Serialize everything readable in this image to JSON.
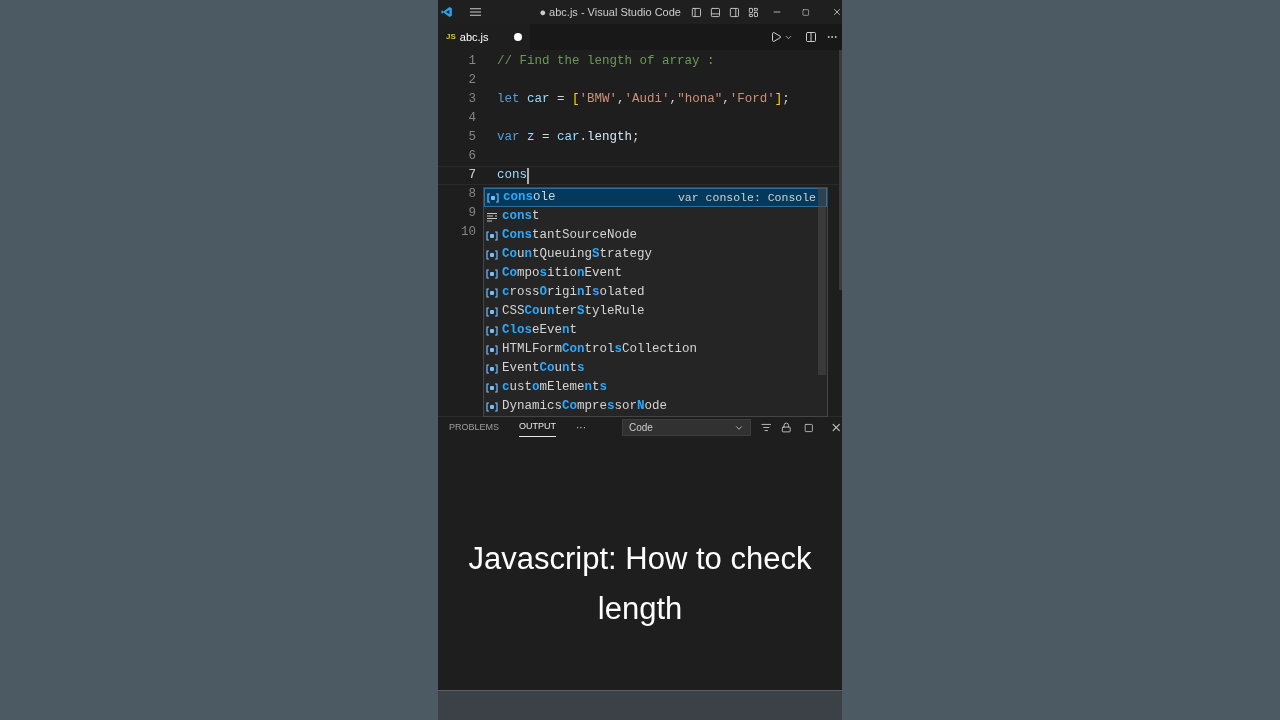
{
  "title_bar": {
    "title": "● abc.js - Visual Studio Code"
  },
  "tabs": [
    {
      "icon_text": "JS",
      "label": "abc.js",
      "selected": true,
      "modified": true
    }
  ],
  "editor": {
    "lines": [
      {
        "number": "1",
        "current": false,
        "tokens": [
          {
            "kind": "comment",
            "text": "// Find the length of array :"
          }
        ]
      },
      {
        "number": "2",
        "current": false
      },
      {
        "number": "3",
        "current": false,
        "tokens": [
          {
            "kind": "keyword",
            "text": "let "
          },
          {
            "kind": "variable",
            "text": "car"
          },
          {
            "kind": "plain",
            "text": " = "
          },
          {
            "kind": "bracket",
            "text": "["
          },
          {
            "kind": "string",
            "text": "'BMW'"
          },
          {
            "kind": "plain",
            "text": ","
          },
          {
            "kind": "string",
            "text": "'Audi'"
          },
          {
            "kind": "plain",
            "text": ","
          },
          {
            "kind": "string",
            "text": "\"hona\""
          },
          {
            "kind": "plain",
            "text": ","
          },
          {
            "kind": "string",
            "text": "'Ford'"
          },
          {
            "kind": "bracket",
            "text": "]"
          },
          {
            "kind": "plain",
            "text": ";"
          }
        ]
      },
      {
        "number": "4",
        "current": false
      },
      {
        "number": "5",
        "current": false,
        "tokens": [
          {
            "kind": "keyword",
            "text": "var "
          },
          {
            "kind": "variable",
            "text": "z"
          },
          {
            "kind": "plain",
            "text": " = "
          },
          {
            "kind": "variable",
            "text": "car"
          },
          {
            "kind": "plain",
            "text": "."
          },
          {
            "kind": "property",
            "text": "length"
          },
          {
            "kind": "plain",
            "text": ";"
          }
        ]
      },
      {
        "number": "6",
        "current": false
      },
      {
        "number": "7",
        "current": true,
        "tokens": [
          {
            "kind": "variable",
            "text": "cons"
          }
        ]
      },
      {
        "number": "8",
        "current": false
      },
      {
        "number": "9",
        "current": false
      },
      {
        "number": "10",
        "current": false
      }
    ]
  },
  "suggest": {
    "items": [
      {
        "kind": "variable",
        "selected": true,
        "detail": "var console: Console",
        "label": "**cons**ole"
      },
      {
        "kind": "keyword",
        "selected": false,
        "label": "**cons**t"
      },
      {
        "kind": "variable",
        "selected": false,
        "label": "**Cons**tantSourceNode"
      },
      {
        "kind": "variable",
        "selected": false,
        "label": "**Co**u**n**tQueuing**S**trategy"
      },
      {
        "kind": "variable",
        "selected": false,
        "label": "**Co**mpo**s**itio**n**Event"
      },
      {
        "kind": "variable",
        "selected": false,
        "label": "**c**ross**O**rigi**n**I**s**olated"
      },
      {
        "kind": "variable",
        "selected": false,
        "label": "CSS**Co**u**n**ter**S**tyleRule"
      },
      {
        "kind": "variable",
        "selected": false,
        "label": "**Clos**eEve**n**t"
      },
      {
        "kind": "variable",
        "selected": false,
        "label": "HTMLForm**Con**trol**s**Collection"
      },
      {
        "kind": "variable",
        "selected": false,
        "label": "Event**Co**u**n**t**s**"
      },
      {
        "kind": "variable",
        "selected": false,
        "label": "**c**ust**o**mEleme**n**t**s**"
      },
      {
        "kind": "variable",
        "selected": false,
        "label": "Dynamics**Co**mpre**s**sor**N**ode"
      }
    ]
  },
  "panel": {
    "tabs": [
      {
        "label": "PROBLEMS",
        "selected": false
      },
      {
        "label": "OUTPUT",
        "selected": true
      }
    ],
    "more": "···",
    "dropdown": "Code"
  },
  "caption": "Javascript: How to check length"
}
